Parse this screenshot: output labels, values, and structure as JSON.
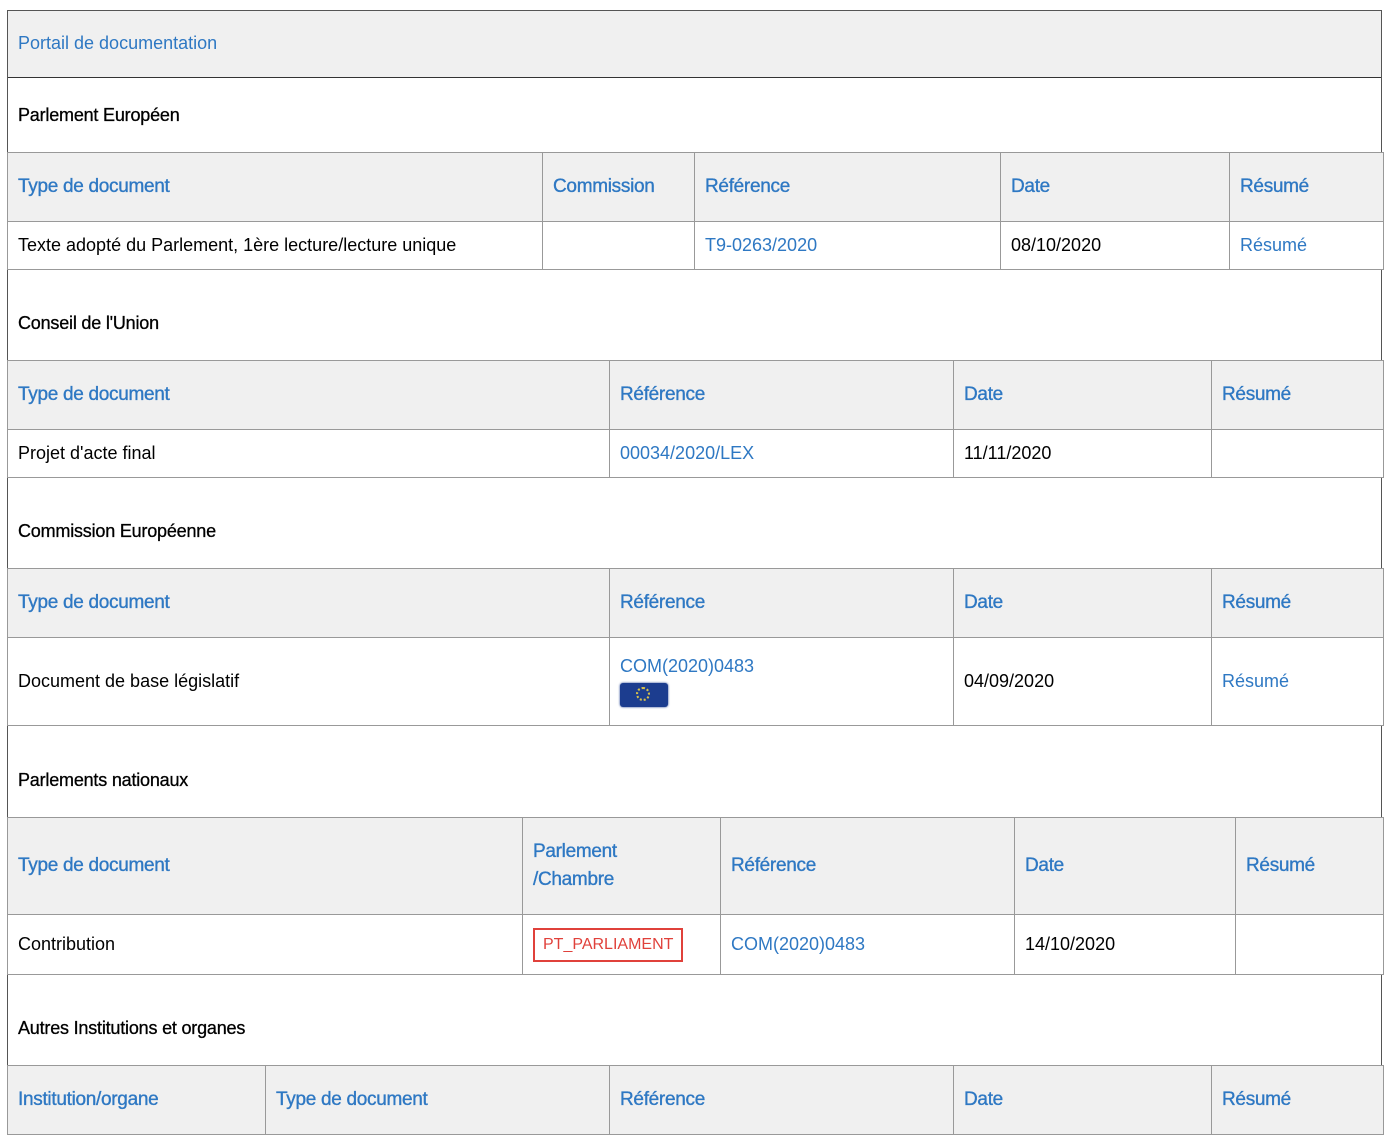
{
  "portal": {
    "title": "Portail de documentation"
  },
  "sections": [
    {
      "title": "Parlement Européen",
      "headers": [
        "Type de document",
        "Commission",
        "Référence",
        "Date",
        "Résumé"
      ],
      "rows": [
        {
          "type": "Texte adopté du Parlement, 1ère lecture/lecture unique",
          "commission": "",
          "reference": "T9-0263/2020",
          "date": "08/10/2020",
          "resume": "Résumé"
        }
      ]
    },
    {
      "title": "Conseil de l'Union",
      "headers": [
        "Type de document",
        "Référence",
        "Date",
        "Résumé"
      ],
      "rows": [
        {
          "type": "Projet d'acte final",
          "reference": "00034/2020/LEX",
          "date": "11/11/2020",
          "resume": ""
        }
      ]
    },
    {
      "title": "Commission Européenne",
      "headers": [
        "Type de document",
        "Référence",
        "Date",
        "Résumé"
      ],
      "rows": [
        {
          "type": "Document de base législatif",
          "reference": "COM(2020)0483",
          "reference_icon": "eu-flag-icon",
          "date": "04/09/2020",
          "resume": "Résumé"
        }
      ]
    },
    {
      "title": "Parlements nationaux",
      "headers": [
        "Type de document",
        "Parlement /Chambre",
        "Référence",
        "Date",
        "Résumé"
      ],
      "rows": [
        {
          "type": "Contribution",
          "parliament": "PT_PARLIAMENT",
          "reference": "COM(2020)0483",
          "date": "14/10/2020",
          "resume": ""
        }
      ]
    },
    {
      "title": "Autres Institutions et organes",
      "headers": [
        "Institution/organe",
        "Type de document",
        "Référence",
        "Date",
        "Résumé"
      ],
      "rows": []
    }
  ],
  "colors": {
    "link": "#2e78c3",
    "header_bg": "#f0f0f0",
    "badge": "#e0413b"
  }
}
